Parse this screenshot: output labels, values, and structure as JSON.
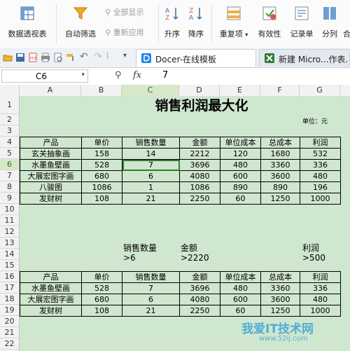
{
  "ribbon": {
    "pivot": "数据透视表",
    "autofilter": "自动筛选",
    "show_all": "全部显示",
    "reapply": "重新应用",
    "sort_asc": "升序",
    "sort_desc": "降序",
    "duplicates": "重复项",
    "validity": "有效性",
    "record": "记录单",
    "split": "分列",
    "more": "合"
  },
  "tabs": [
    {
      "label": "Docer-在线模板"
    },
    {
      "label": "新建 Micro...作表."
    }
  ],
  "formula": {
    "name_box": "C6",
    "fx": "fx",
    "value": "7"
  },
  "columns": [
    "A",
    "B",
    "C",
    "D",
    "E",
    "F",
    "G"
  ],
  "rows": [
    "1",
    "2",
    "3",
    "4",
    "5",
    "6",
    "7",
    "8",
    "9",
    "10",
    "11",
    "12",
    "13",
    "14",
    "15",
    "16",
    "17",
    "18",
    "19",
    "20",
    "21",
    "22"
  ],
  "sheet": {
    "title": "销售利润最大化",
    "unit": "单位：元",
    "headers": [
      "产品",
      "单价",
      "销售数量",
      "金额",
      "单位成本",
      "总成本",
      "利润"
    ],
    "table1": [
      [
        "玄关抽象画",
        "158",
        "14",
        "2212",
        "120",
        "1680",
        "532"
      ],
      [
        "水墨鱼壁画",
        "528",
        "7",
        "3696",
        "480",
        "3360",
        "336"
      ],
      [
        "大展宏图字画",
        "680",
        "6",
        "4080",
        "600",
        "3600",
        "480"
      ],
      [
        "八骏图",
        "1086",
        "1",
        "1086",
        "890",
        "890",
        "196"
      ],
      [
        "发财树",
        "108",
        "21",
        "2250",
        "60",
        "1250",
        "1000"
      ]
    ],
    "criteria_headers": [
      "销售数量",
      "金额",
      "利润"
    ],
    "criteria_values": [
      ">6",
      ">2220",
      ">500"
    ],
    "table2": [
      [
        "水墨鱼壁画",
        "528",
        "7",
        "3696",
        "480",
        "3360",
        "336"
      ],
      [
        "大展宏图字画",
        "680",
        "6",
        "4080",
        "600",
        "3600",
        "480"
      ],
      [
        "发财树",
        "108",
        "21",
        "2250",
        "60",
        "1250",
        "1000"
      ]
    ]
  },
  "watermark": {
    "text": "我爱IT技术网",
    "url": "www.52ij.com"
  },
  "colors": {
    "sheet_bg": "#cfe6cf",
    "selection": "#2e7d32",
    "accent": "#f5a623"
  }
}
